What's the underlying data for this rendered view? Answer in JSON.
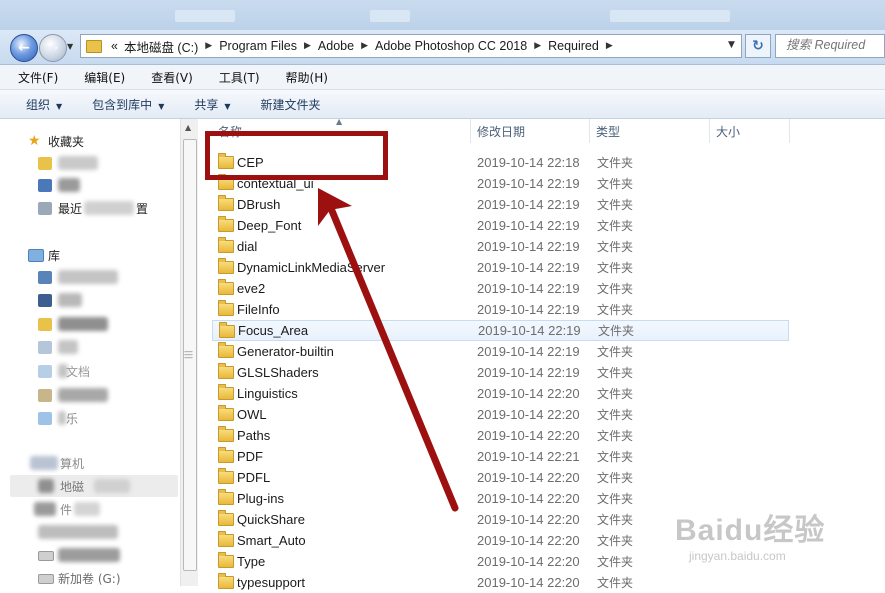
{
  "window": {
    "address_path": [
      "本地磁盘 (C:)",
      "Program Files",
      "Adobe",
      "Adobe Photoshop CC 2018",
      "Required"
    ],
    "address_overflow": "«",
    "search_placeholder": "搜索 Required"
  },
  "menu": [
    "文件(F)",
    "编辑(E)",
    "查看(V)",
    "工具(T)",
    "帮助(H)"
  ],
  "commands": [
    {
      "label": "组织",
      "has_dropdown": true
    },
    {
      "label": "包含到库中",
      "has_dropdown": true
    },
    {
      "label": "共享",
      "has_dropdown": true
    },
    {
      "label": "新建文件夹",
      "has_dropdown": false
    }
  ],
  "sidebar": {
    "favorites_label": "收藏夹",
    "favorites_items": [
      "最近",
      "置"
    ],
    "libraries_label": "库",
    "library_items": [
      "文档",
      "乐"
    ],
    "computer_label": "算机",
    "computer_items": [
      "地磁",
      "件",
      "新加卷 (G:)"
    ]
  },
  "columns": {
    "name": "名称",
    "date": "修改日期",
    "type": "类型",
    "size": "大小"
  },
  "files": [
    {
      "name": "CEP",
      "date": "2019-10-14 22:18",
      "type": "文件夹"
    },
    {
      "name": "contextual_ui",
      "date": "2019-10-14 22:19",
      "type": "文件夹"
    },
    {
      "name": "DBrush",
      "date": "2019-10-14 22:19",
      "type": "文件夹"
    },
    {
      "name": "Deep_Font",
      "date": "2019-10-14 22:19",
      "type": "文件夹"
    },
    {
      "name": "dial",
      "date": "2019-10-14 22:19",
      "type": "文件夹"
    },
    {
      "name": "DynamicLinkMediaServer",
      "date": "2019-10-14 22:19",
      "type": "文件夹"
    },
    {
      "name": "eve2",
      "date": "2019-10-14 22:19",
      "type": "文件夹"
    },
    {
      "name": "FileInfo",
      "date": "2019-10-14 22:19",
      "type": "文件夹"
    },
    {
      "name": "Focus_Area",
      "date": "2019-10-14 22:19",
      "type": "文件夹"
    },
    {
      "name": "Generator-builtin",
      "date": "2019-10-14 22:19",
      "type": "文件夹"
    },
    {
      "name": "GLSLShaders",
      "date": "2019-10-14 22:19",
      "type": "文件夹"
    },
    {
      "name": "Linguistics",
      "date": "2019-10-14 22:20",
      "type": "文件夹"
    },
    {
      "name": "OWL",
      "date": "2019-10-14 22:20",
      "type": "文件夹"
    },
    {
      "name": "Paths",
      "date": "2019-10-14 22:20",
      "type": "文件夹"
    },
    {
      "name": "PDF",
      "date": "2019-10-14 22:21",
      "type": "文件夹"
    },
    {
      "name": "PDFL",
      "date": "2019-10-14 22:20",
      "type": "文件夹"
    },
    {
      "name": "Plug-ins",
      "date": "2019-10-14 22:20",
      "type": "文件夹"
    },
    {
      "name": "QuickShare",
      "date": "2019-10-14 22:20",
      "type": "文件夹"
    },
    {
      "name": "Smart_Auto",
      "date": "2019-10-14 22:20",
      "type": "文件夹"
    },
    {
      "name": "Type",
      "date": "2019-10-14 22:20",
      "type": "文件夹"
    },
    {
      "name": "typesupport",
      "date": "2019-10-14 22:20",
      "type": "文件夹"
    }
  ],
  "selected_file": "Focus_Area",
  "annotation": {
    "highlighted_item": "CEP",
    "color": "#9d1010"
  },
  "watermark": {
    "main": "Baidu经验",
    "sub": "jingyan.baidu.com"
  }
}
